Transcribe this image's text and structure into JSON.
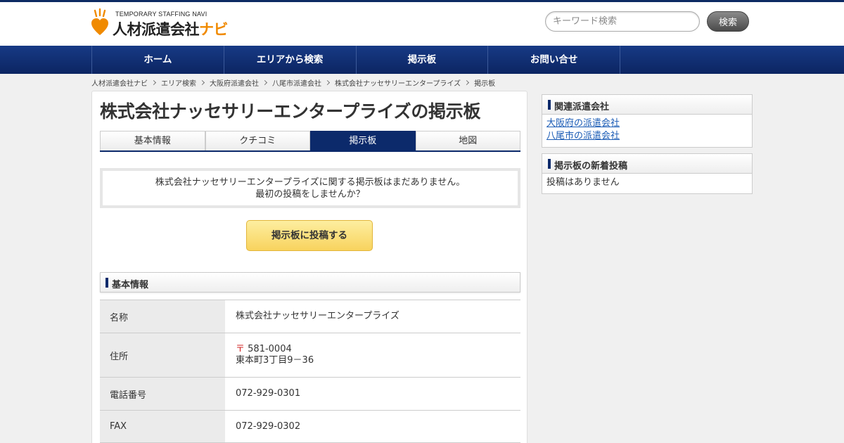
{
  "header": {
    "logo_sub": "TEMPORARY STAFFING NAVI",
    "logo_main": "人材派遣会社",
    "logo_navi": "ナビ",
    "search_placeholder": "キーワード検索",
    "search_button": "検索"
  },
  "nav": {
    "items": [
      "ホーム",
      "エリアから検索",
      "掲示板",
      "お問い合せ"
    ]
  },
  "breadcrumb": [
    "人材派遣会社ナビ",
    "エリア検索",
    "大阪府派遣会社",
    "八尾市派遣会社",
    "株式会社ナッセサリーエンタープライズ",
    "掲示板"
  ],
  "main": {
    "title": "株式会社ナッセサリーエンタープライズの掲示板",
    "tabs": [
      "基本情報",
      "クチコミ",
      "掲示板",
      "地図"
    ],
    "notice_line1": "株式会社ナッセサリーエンタープライズに関する掲示板はまだありません。",
    "notice_line2": "最初の投稿をしませんか？",
    "post_button": "掲示板に投稿する",
    "info_heading": "基本情報",
    "info": {
      "name_label": "名称",
      "name_value": "株式会社ナッセサリーエンタープライズ",
      "address_label": "住所",
      "postal_mark": "〒",
      "postal_code": "581-0004",
      "address_value": "東本町3丁目9－36",
      "phone_label": "電話番号",
      "phone_value": "072-929-0301",
      "fax_label": "FAX",
      "fax_value": "072-929-0302"
    }
  },
  "sidebar": {
    "related_heading": "関連派遣会社",
    "related_links": [
      "大阪府の派遣会社",
      "八尾市の派遣会社"
    ],
    "new_posts_heading": "掲示板の新着投稿",
    "new_posts_empty": "投稿はありません"
  },
  "colors": {
    "navy": "#0c2a6b",
    "accent_orange": "#f08a00",
    "button_yellow": "#f8d35e",
    "link_blue": "#1a5bb5"
  }
}
